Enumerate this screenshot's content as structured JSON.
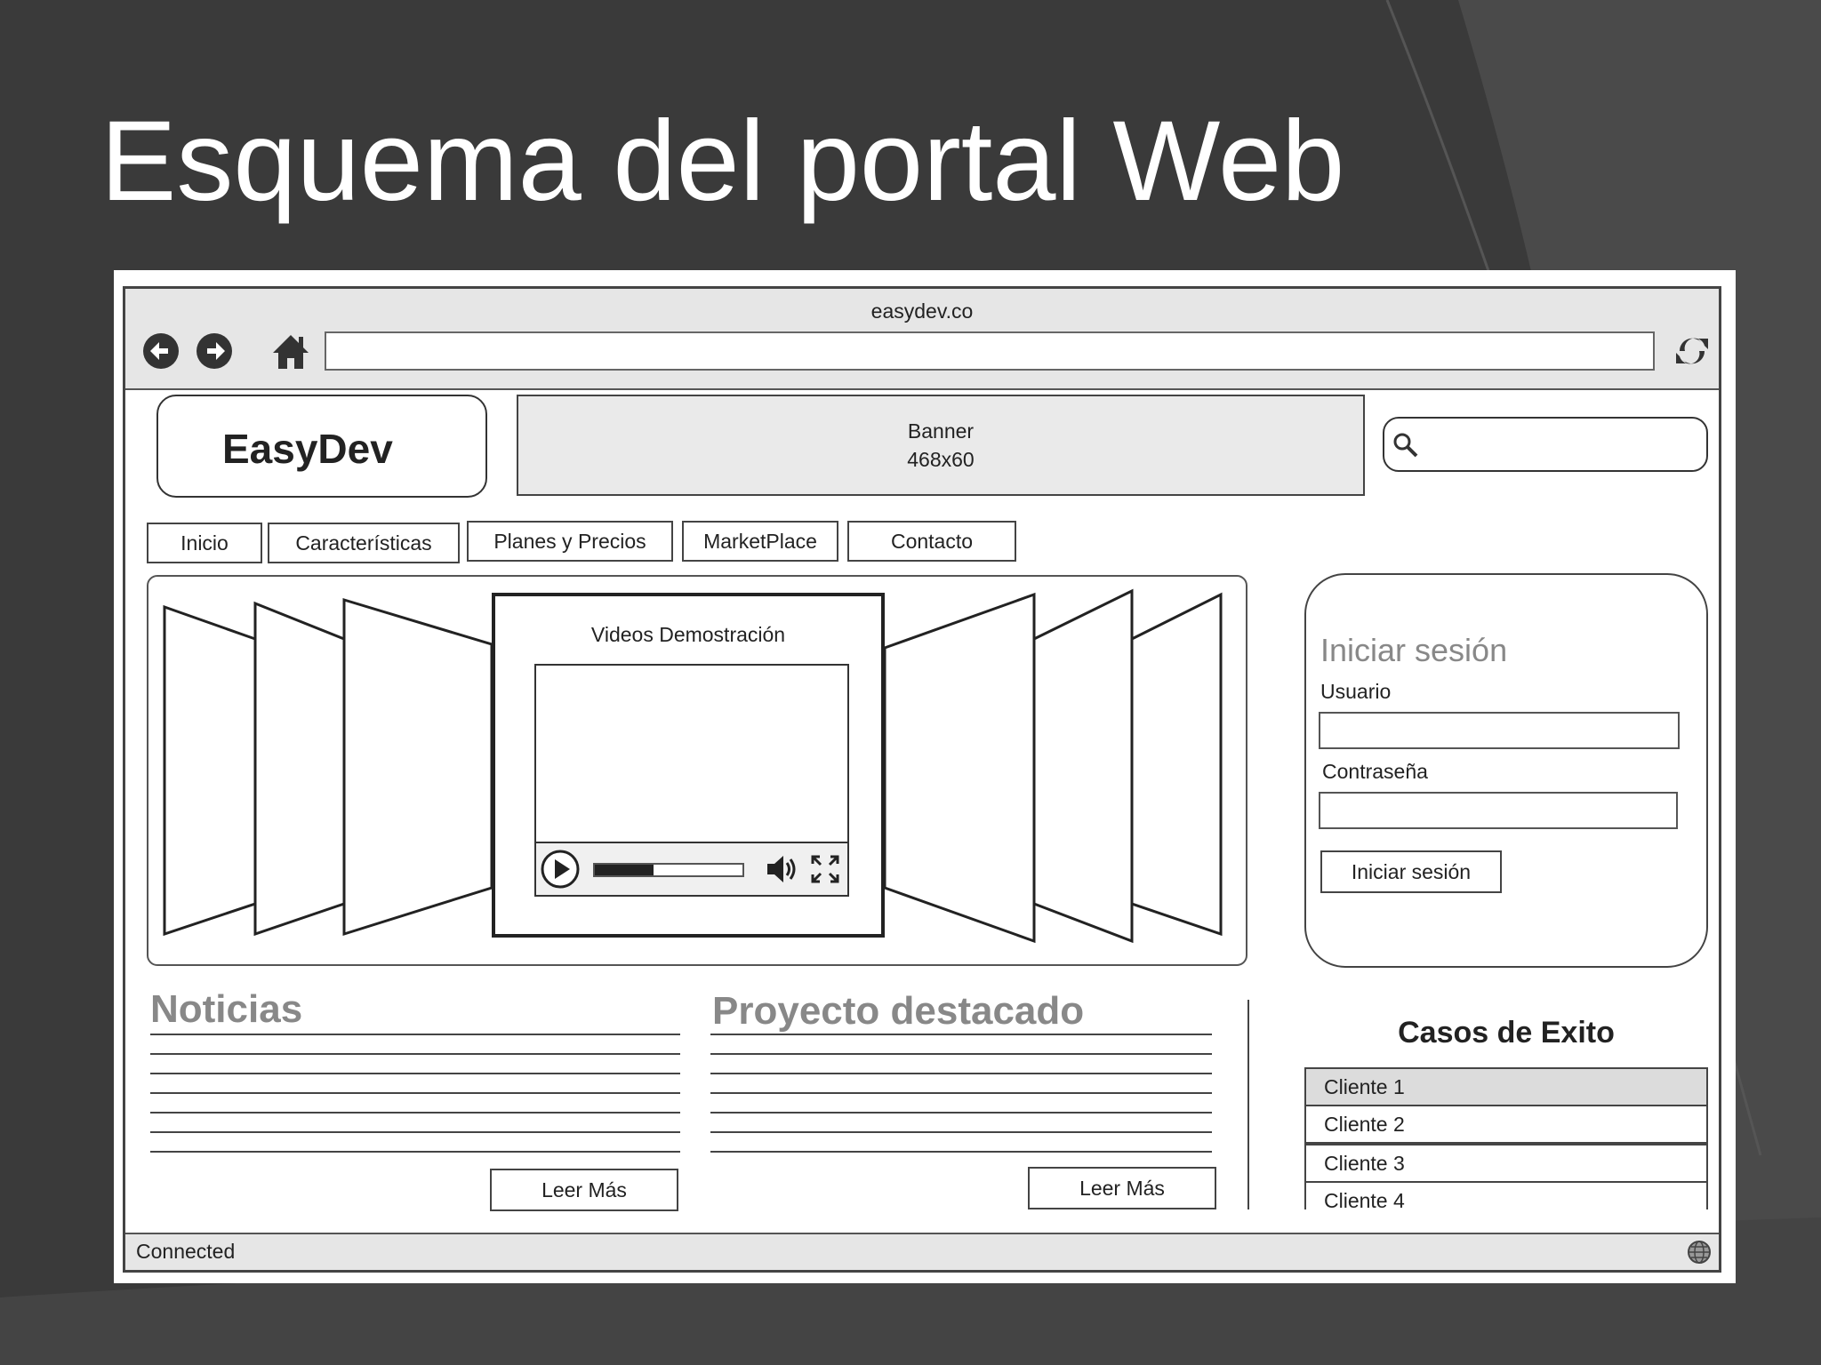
{
  "slide": {
    "title": "Esquema del portal Web"
  },
  "browser": {
    "window_title": "easydev.co",
    "url": "",
    "status": "Connected",
    "icons": [
      "back-arrow-icon",
      "forward-arrow-icon",
      "home-icon",
      "refresh-icon",
      "globe-icon"
    ]
  },
  "header": {
    "logo": "EasyDev",
    "banner_line1": "Banner",
    "banner_line2": "468x60",
    "search_placeholder": ""
  },
  "menu": {
    "items": [
      "Inicio",
      "Características",
      "Planes y Precios",
      "MarketPlace",
      "Contacto"
    ]
  },
  "carousel": {
    "title": "Videos Demostración",
    "player": {
      "progress": 0.4,
      "controls": [
        "play-icon",
        "volume-icon",
        "fullscreen-icon"
      ]
    }
  },
  "login": {
    "title": "Iniciar sesión",
    "user_label": "Usuario",
    "password_label": "Contraseña",
    "button": "Iniciar sesión"
  },
  "news": {
    "title": "Noticias",
    "more": "Leer Más"
  },
  "featured": {
    "title": "Proyecto destacado",
    "more": "Leer Más"
  },
  "cases": {
    "title": "Casos de Exito",
    "items": [
      "Cliente 1",
      "Cliente 2",
      "Cliente 3",
      "Cliente 4"
    ],
    "selected_index": 0
  },
  "colors": {
    "slide_bg": "#3a3a3a",
    "chrome_bg": "#e6e6e6",
    "muted_title": "#888888"
  }
}
